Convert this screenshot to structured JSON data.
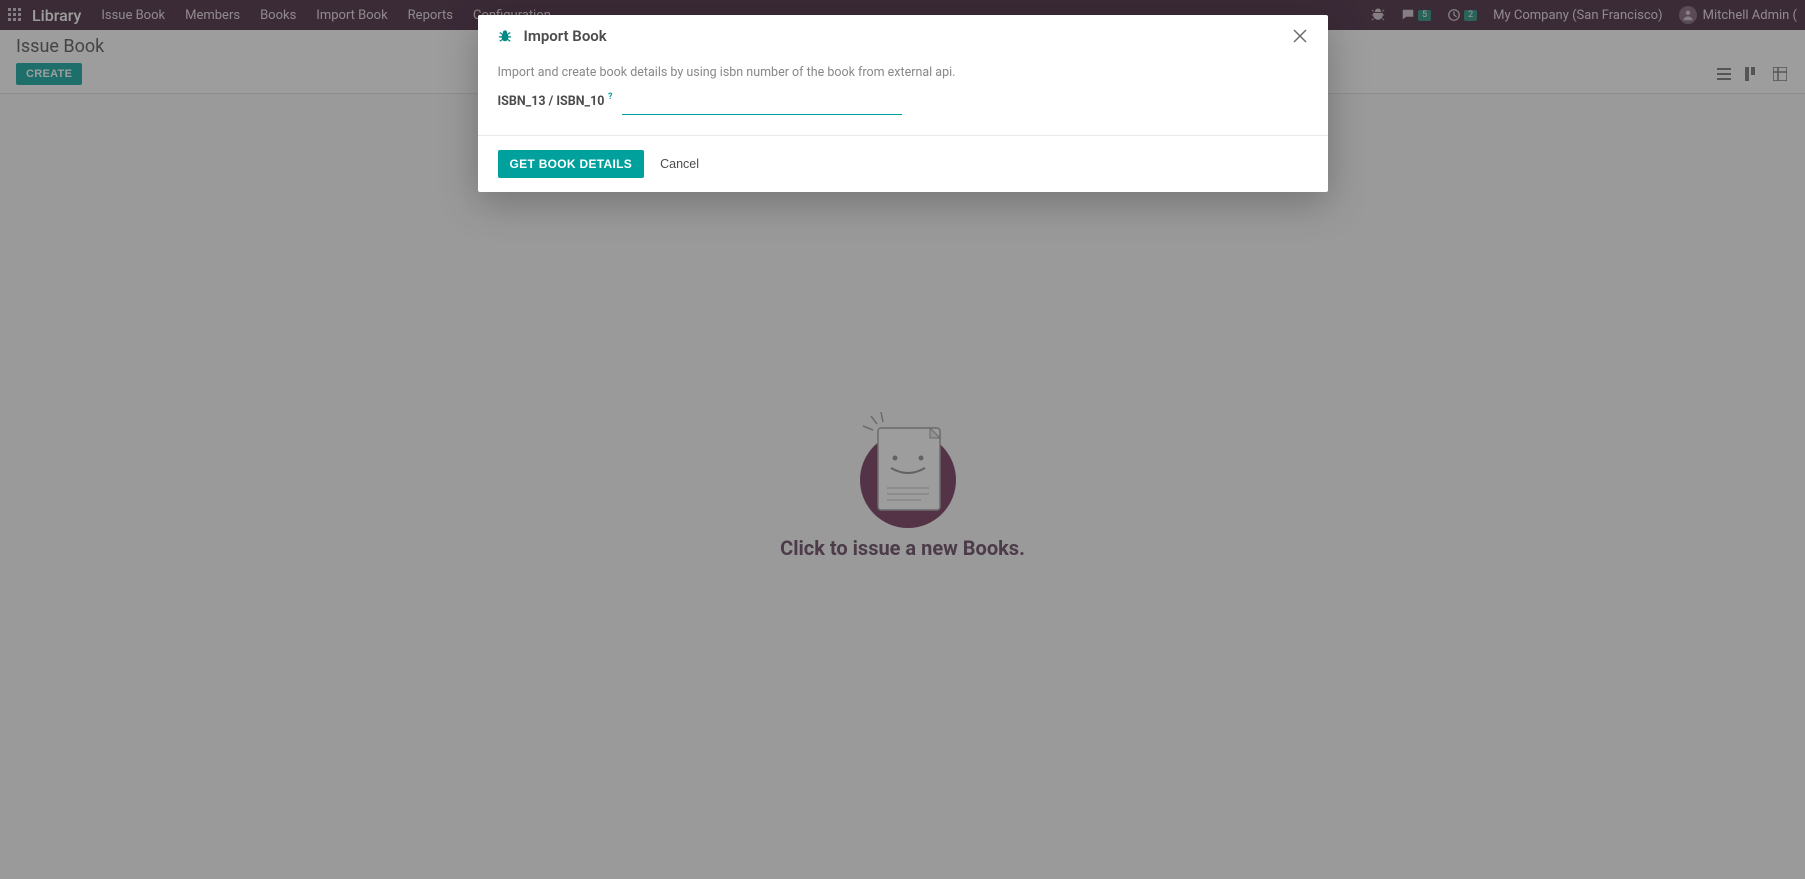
{
  "navbar": {
    "brand": "Library",
    "items": [
      "Issue Book",
      "Members",
      "Books",
      "Import Book",
      "Reports",
      "Configuration"
    ],
    "messages_badge": "5",
    "activities_badge": "2",
    "company": "My Company (San Francisco)",
    "user": "Mitchell Admin ("
  },
  "control_panel": {
    "breadcrumb": "Issue Book",
    "create_label": "CREATE"
  },
  "empty": {
    "title": "Click to issue a new Books."
  },
  "modal": {
    "title": "Import Book",
    "description": "Import and create book details by using isbn number of the book from external api.",
    "field_label": "ISBN_13 / ISBN_10",
    "field_value": "",
    "help_symbol": "?",
    "primary_btn": "GET BOOK DETAILS",
    "cancel_btn": "Cancel"
  }
}
